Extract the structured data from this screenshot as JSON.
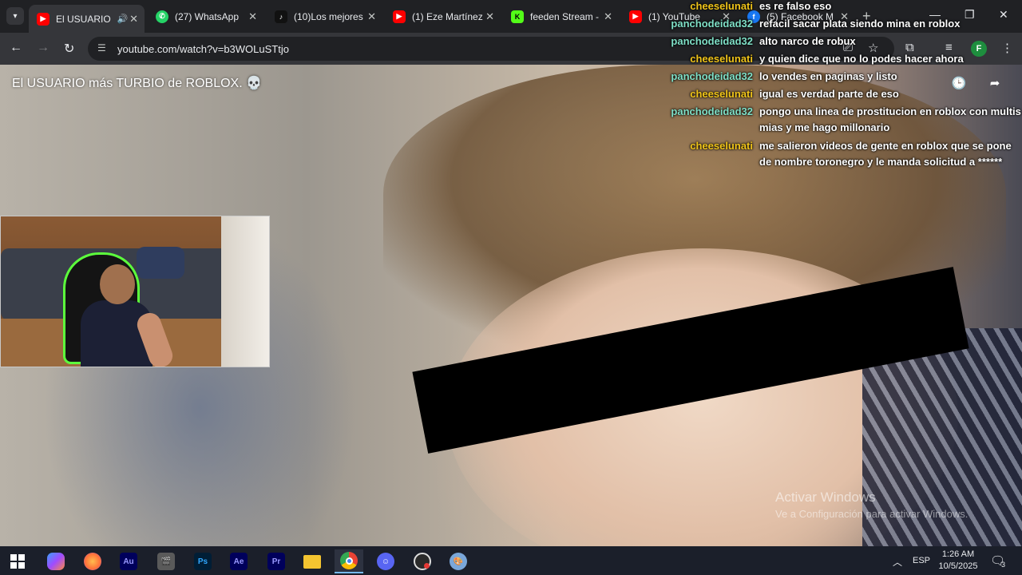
{
  "browser": {
    "tabs": [
      {
        "title": "El USUARIO",
        "icon": "youtube-icon",
        "color": "#ff0000",
        "active": true,
        "audio": true
      },
      {
        "title": "(27) WhatsApp",
        "icon": "whatsapp-icon",
        "color": "#25d366",
        "active": false
      },
      {
        "title": "(10)Los mejores",
        "icon": "tiktok-icon",
        "color": "#111111",
        "active": false
      },
      {
        "title": "(1) Eze Martínez",
        "icon": "youtube-icon",
        "color": "#ff0000",
        "active": false
      },
      {
        "title": "feeden Stream -",
        "icon": "kick-icon",
        "color": "#53fc18",
        "active": false
      },
      {
        "title": "(1) YouTube",
        "icon": "youtube-icon",
        "color": "#ff0000",
        "active": false
      },
      {
        "title": "(5) Facebook M",
        "icon": "facebook-icon",
        "color": "#1877f2",
        "active": false
      }
    ],
    "url": "youtube.com/watch?v=b3WOLuSTtjo",
    "profile_initial": "F"
  },
  "video": {
    "title": "El USUARIO más TURBIO de ROBLOX. 💀"
  },
  "chat": {
    "messages": [
      {
        "user": "cheeselunati",
        "user_color": "#f0c419",
        "text": "es re falso eso"
      },
      {
        "user": "panchodeidad32",
        "user_color": "#7fe0c7",
        "text": "refacil sacar plata siendo mina en roblox"
      },
      {
        "user": "panchodeidad32",
        "user_color": "#7fe0c7",
        "text": "alto narco de robux"
      },
      {
        "user": "cheeselunati",
        "user_color": "#f0c419",
        "text": "y quien dice que no lo podes hacer ahora"
      },
      {
        "user": "panchodeidad32",
        "user_color": "#7fe0c7",
        "text": "lo vendes en paginas y listo"
      },
      {
        "user": "cheeselunati",
        "user_color": "#f0c419",
        "text": "igual es verdad parte de eso"
      },
      {
        "user": "panchodeidad32",
        "user_color": "#7fe0c7",
        "text": "pongo una linea de prostitucion en roblox con multis",
        "text2": "mias y me hago millonario"
      },
      {
        "user": "cheeselunati",
        "user_color": "#f0c419",
        "text": "me salieron videos de gente en roblox que se pone",
        "text2": "de nombre toronegro y le manda solicitud a ******"
      }
    ]
  },
  "watermark": {
    "title": "Activar Windows",
    "subtitle": "Ve a Configuración para activar Windows."
  },
  "taskbar": {
    "apps": [
      {
        "name": "windows-start",
        "icon": "windows-logo-icon",
        "color": "#ffffff"
      },
      {
        "name": "copilot",
        "icon": "copilot-icon",
        "color": "#3aa0ff"
      },
      {
        "name": "firefox",
        "icon": "firefox-icon",
        "color": "#ff7139"
      },
      {
        "name": "audition",
        "icon": "audition-icon",
        "color": "#00005b",
        "glyph": "Au"
      },
      {
        "name": "clapper",
        "icon": "clapperboard-icon",
        "color": "#6b6b6b"
      },
      {
        "name": "photoshop",
        "icon": "photoshop-icon",
        "color": "#001e36",
        "glyph": "Ps"
      },
      {
        "name": "after-effects",
        "icon": "after-effects-icon",
        "color": "#00005b",
        "glyph": "Ae"
      },
      {
        "name": "premiere",
        "icon": "premiere-icon",
        "color": "#00005b",
        "glyph": "Pr"
      },
      {
        "name": "file-explorer",
        "icon": "folder-icon",
        "color": "#f4c430"
      },
      {
        "name": "chrome",
        "icon": "chrome-icon",
        "color": "#4285f4"
      },
      {
        "name": "discord",
        "icon": "discord-icon",
        "color": "#5865f2"
      },
      {
        "name": "obs",
        "icon": "obs-icon",
        "color": "#2a2a2a"
      },
      {
        "name": "paint",
        "icon": "paint-icon",
        "color": "#7aa7d9"
      }
    ],
    "language": "ESP",
    "time": "1:26 AM",
    "date": "10/5/2025",
    "notification_count": "3"
  }
}
